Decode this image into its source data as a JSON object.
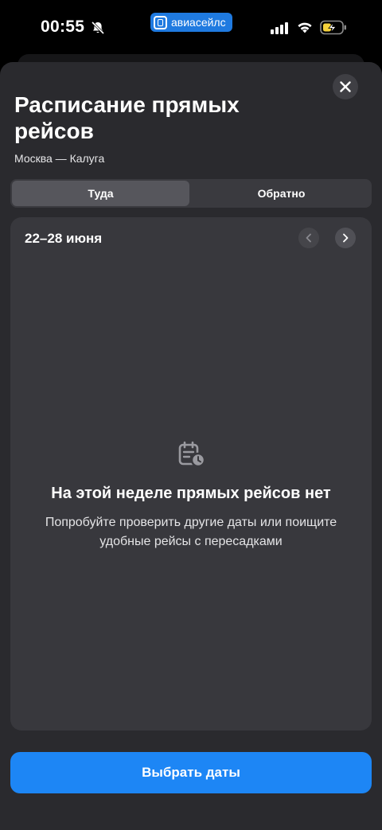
{
  "status_bar": {
    "time": "00:55",
    "app_pill_label": "авиасейлс",
    "icons": [
      "bell-slash-icon",
      "signal-icon",
      "wifi-icon",
      "battery-charging-icon"
    ]
  },
  "header": {
    "title": "Расписание прямых рейсов",
    "route": "Москва — Калуга",
    "close_icon": "close-icon"
  },
  "tabs": [
    {
      "label": "Туда",
      "active": true
    },
    {
      "label": "Обратно",
      "active": false
    }
  ],
  "week": {
    "label": "22–28 июня",
    "prev_icon": "chevron-left-icon",
    "next_icon": "chevron-right-icon"
  },
  "empty_state": {
    "icon": "calendar-clock-icon",
    "title": "На этой неделе прямых рейсов нет",
    "text": "Попробуйте проверить другие даты или поищите удобные рейсы с пересадками"
  },
  "footer": {
    "button_label": "Выбрать даты"
  },
  "colors": {
    "accent": "#1d86f5",
    "sheet": "#2a2a2e",
    "card": "#38383d",
    "battery_accent": "#f5d23c"
  }
}
